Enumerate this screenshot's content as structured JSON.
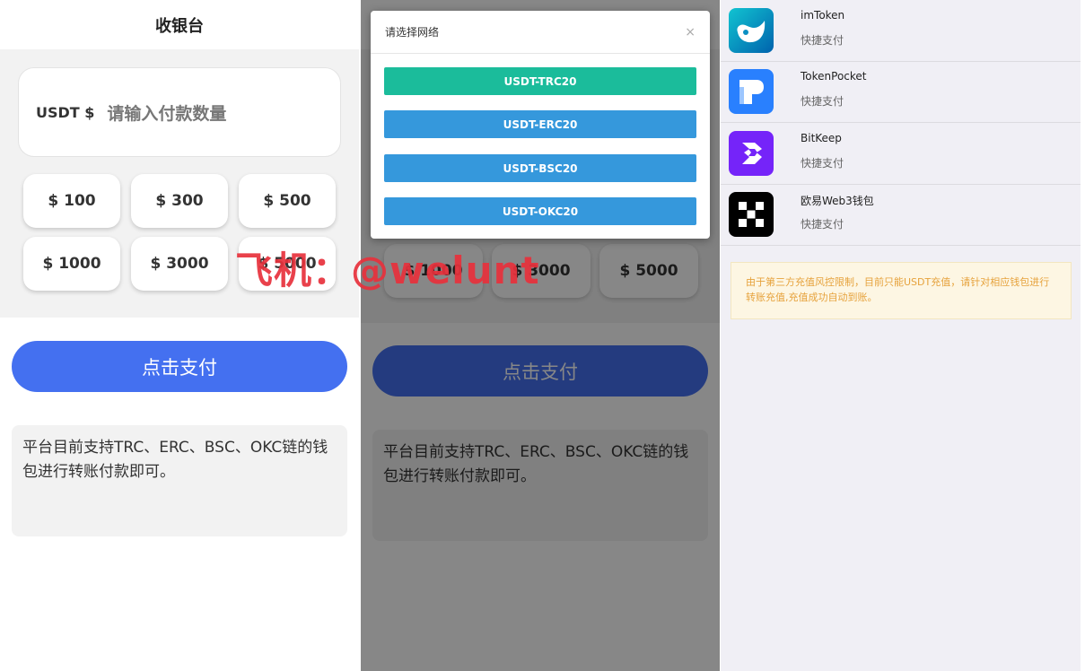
{
  "panel1": {
    "title": "收银台",
    "currency_label": "USDT $",
    "amount_placeholder": "请输入付款数量",
    "amounts": [
      "$ 100",
      "$ 300",
      "$ 500",
      "$ 1000",
      "$ 3000",
      "$ 5000"
    ],
    "pay_button": "点击支付",
    "note": "平台目前支持TRC、ERC、BSC、OKC链的钱包进行转账付款即可。"
  },
  "watermark": "飞机：@welunt",
  "panel2": {
    "modal_title": "请选择网络",
    "close": "×",
    "networks": [
      "USDT-TRC20",
      "USDT-ERC20",
      "USDT-BSC20",
      "USDT-OKC20"
    ],
    "network_colors": [
      "#1bbc9b",
      "#3598dc",
      "#3598dc",
      "#3598dc"
    ],
    "amounts": [
      "$ 1000",
      "$ 3000",
      "$ 5000"
    ],
    "pay_button": "点击支付",
    "note": "平台目前支持TRC、ERC、BSC、OKC链的钱包进行转账付款即可。"
  },
  "panel3": {
    "wallets": [
      {
        "name": "imToken",
        "sub": "快捷支付",
        "icon": "imtoken-icon"
      },
      {
        "name": "TokenPocket",
        "sub": "快捷支付",
        "icon": "tokenpocket-icon"
      },
      {
        "name": "BitKeep",
        "sub": "快捷支付",
        "icon": "bitkeep-icon"
      },
      {
        "name": "欧易Web3钱包",
        "sub": "快捷支付",
        "icon": "okx-icon"
      }
    ],
    "notice": "由于第三方充值风控限制，目前只能USDT充值，请针对相应钱包进行转账充值,充值成功自动到账。"
  },
  "colors": {
    "pay_blue": "#4470f0",
    "trc_green": "#1bbc9b",
    "net_blue": "#3598dc",
    "warning_text": "#e6a23c"
  }
}
